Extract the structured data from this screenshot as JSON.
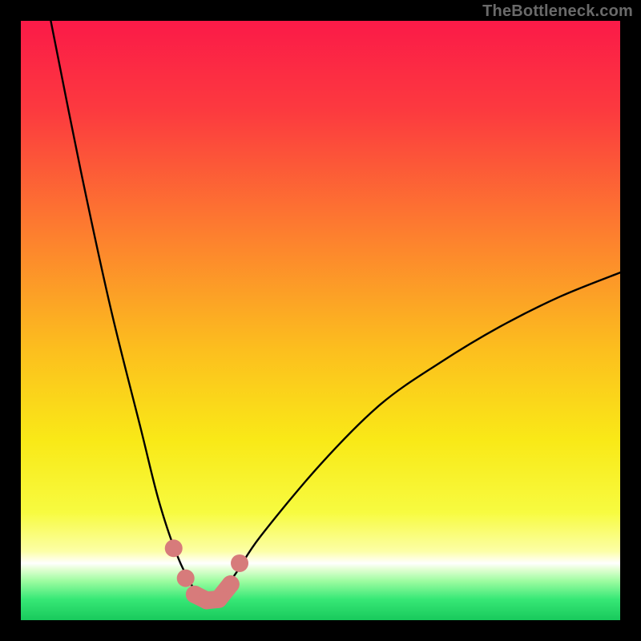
{
  "attribution": "TheBottleneck.com",
  "colors": {
    "frame": "#000000",
    "curve": "#000000",
    "marker": "#d77b7b",
    "gradient_stops": [
      {
        "offset": 0.0,
        "color": "#fb1a48"
      },
      {
        "offset": 0.15,
        "color": "#fc3a3f"
      },
      {
        "offset": 0.35,
        "color": "#fd7d2f"
      },
      {
        "offset": 0.55,
        "color": "#fcbf1e"
      },
      {
        "offset": 0.7,
        "color": "#f9e917"
      },
      {
        "offset": 0.82,
        "color": "#f7fb40"
      },
      {
        "offset": 0.885,
        "color": "#fcffa6"
      },
      {
        "offset": 0.905,
        "color": "#ffffff"
      },
      {
        "offset": 0.915,
        "color": "#e3ffd4"
      },
      {
        "offset": 0.935,
        "color": "#9cfca0"
      },
      {
        "offset": 0.965,
        "color": "#37e876"
      },
      {
        "offset": 1.0,
        "color": "#18c95c"
      }
    ]
  },
  "chart_data": {
    "type": "line",
    "title": "",
    "xlabel": "",
    "ylabel": "",
    "xlim": [
      0,
      100
    ],
    "ylim": [
      0,
      100
    ],
    "description": "V-shaped bottleneck curve. Y is mismatch percentage (high=red=bad, low=green=good). X is a scaled parameter. Minimum (best) is near x≈31 with y≈3. Curve rises steeply to the left toward y≈100 at x≈5 and more gently to the right toward y≈58 at x≈100.",
    "series": [
      {
        "name": "bottleneck-curve",
        "x": [
          5,
          10,
          15,
          20,
          23,
          26,
          29,
          31,
          33,
          36,
          40,
          50,
          60,
          70,
          80,
          90,
          100
        ],
        "y": [
          100,
          75,
          52,
          32,
          20,
          11,
          5,
          3,
          4,
          8,
          14,
          26,
          36,
          43,
          49,
          54,
          58
        ]
      }
    ],
    "markers": {
      "name": "highlighted-region",
      "x": [
        25.5,
        27.5,
        29,
        31,
        33,
        35,
        36.5
      ],
      "y": [
        12,
        7,
        4.3,
        3.3,
        3.5,
        6,
        9.5
      ]
    }
  }
}
